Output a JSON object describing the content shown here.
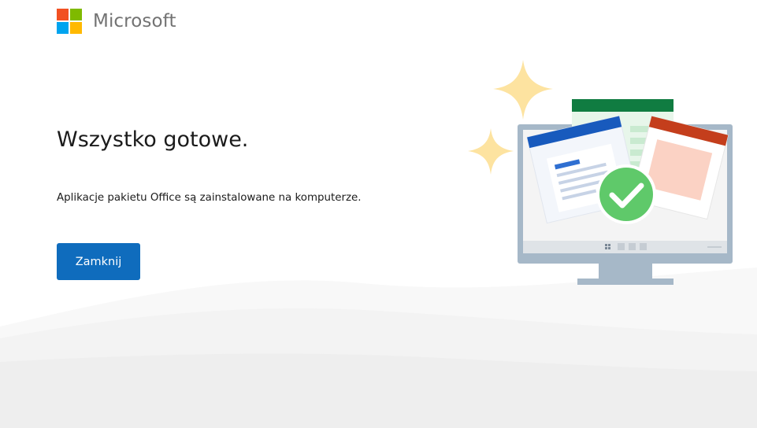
{
  "brand": {
    "name": "Microsoft",
    "logo_icon": "microsoft-logo-icon",
    "logo_colors": [
      "#f25022",
      "#7fba00",
      "#00a4ef",
      "#ffb900"
    ]
  },
  "main": {
    "title": "Wszystko gotowe.",
    "message": "Aplikacje pakietu Office są zainstalowane na komputerze.",
    "close_button_label": "Zamknij"
  },
  "illustration": {
    "icon": "office-installed-monitor-illustration",
    "sparkle_icon": "sparkle-icon",
    "check_icon": "checkmark-icon",
    "colors": {
      "word": "#185abd",
      "excel": "#107c41",
      "powerpoint": "#c43e1c",
      "check": "#5fc96a",
      "sparkle": "#fde3a0",
      "monitor": "#a6b8c8"
    }
  },
  "colors": {
    "accent": "#0f6cbd",
    "text": "#1b1b1b",
    "brand_text": "#737373"
  }
}
